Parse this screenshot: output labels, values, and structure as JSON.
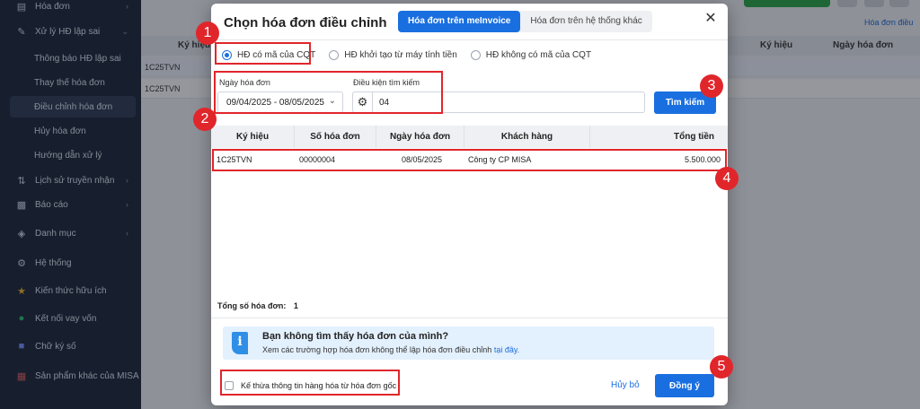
{
  "sidebar": {
    "items": [
      {
        "label": "Hóa đơn",
        "icon": "invoice-icon",
        "chevron": ">"
      },
      {
        "label": "Xử lý HĐ lập sai",
        "icon": "edit-doc-icon",
        "chevron": "v"
      },
      {
        "label": "Lịch sử truyền nhận",
        "icon": "transfer-icon",
        "chevron": ">"
      },
      {
        "label": "Báo cáo",
        "icon": "bar-chart-icon",
        "chevron": ">"
      },
      {
        "label": "Danh mục",
        "icon": "cube-icon",
        "chevron": ">"
      },
      {
        "label": "Hệ thống",
        "icon": "gear-icon",
        "chevron": ""
      },
      {
        "label": "Kiến thức hữu ích",
        "icon": "lightbulb-icon",
        "chevron": ""
      },
      {
        "label": "Kết nối vay vốn",
        "icon": "link-icon",
        "chevron": ""
      },
      {
        "label": "Chữ ký số",
        "icon": "signature-icon",
        "chevron": ""
      },
      {
        "label": "Sản phẩm khác của MISA",
        "icon": "apps-grid-icon",
        "chevron": ""
      }
    ],
    "subitems": [
      {
        "label": "Thông báo HĐ lập sai",
        "active": false
      },
      {
        "label": "Thay thế hóa đơn",
        "active": false
      },
      {
        "label": "Điều chỉnh hóa đơn",
        "active": true
      },
      {
        "label": "Hủy hóa đơn",
        "active": false
      },
      {
        "label": "Hướng dẫn xử lý",
        "active": false
      }
    ]
  },
  "background": {
    "header_cols": [
      "Ký hiệu",
      "Ký hiệu",
      "Ngày hóa đơn"
    ],
    "link_text": "Hóa đơn điều",
    "rows": [
      "1C25TVN",
      "1C25TVN"
    ]
  },
  "modal": {
    "title": "Chọn hóa đơn điều chỉnh",
    "tabs": [
      {
        "label": "Hóa đơn trên meInvoice",
        "active": true
      },
      {
        "label": "Hóa đơn trên hệ thống khác",
        "active": false
      }
    ],
    "close_icon": "close-icon",
    "radios": [
      {
        "label": "HĐ có mã của CQT",
        "checked": true
      },
      {
        "label": "HĐ khởi tạo từ máy tính tiền",
        "checked": false
      },
      {
        "label": "HĐ không có mã của CQT",
        "checked": false
      }
    ],
    "date_label": "Ngày hóa đơn",
    "date_value": "09/04/2025 - 08/05/2025",
    "condition_label": "Điều kiện tìm kiếm",
    "condition_value": "04",
    "search_button": "Tìm kiếm",
    "table": {
      "headers": [
        "Ký hiệu",
        "Số hóa đơn",
        "Ngày hóa đơn",
        "Khách hàng",
        "Tổng tiền"
      ],
      "rows": [
        {
          "symbol": "1C25TVN",
          "number": "00000004",
          "date": "08/05/2025",
          "customer": "Công ty CP MISA",
          "total": "5.500.000"
        }
      ]
    },
    "total_label": "Tổng số hóa đơn:",
    "total_count": "1",
    "hint": {
      "icon": "info-icon",
      "title": "Bạn không tìm thấy hóa đơn của mình?",
      "text": "Xem các trường hợp hóa đơn không thể lập hóa đơn điều chỉnh",
      "link": "tại đây."
    },
    "inherit_checkbox": "Kế thừa thông tin hàng hóa từ hóa đơn gốc",
    "cancel_button": "Hủy bỏ",
    "ok_button": "Đồng ý"
  },
  "annotations": [
    "1",
    "2",
    "3",
    "4",
    "5"
  ],
  "colors": {
    "primary": "#1a6fe0",
    "annotation": "#e0262b",
    "sidebar_bg": "#1b2538"
  }
}
